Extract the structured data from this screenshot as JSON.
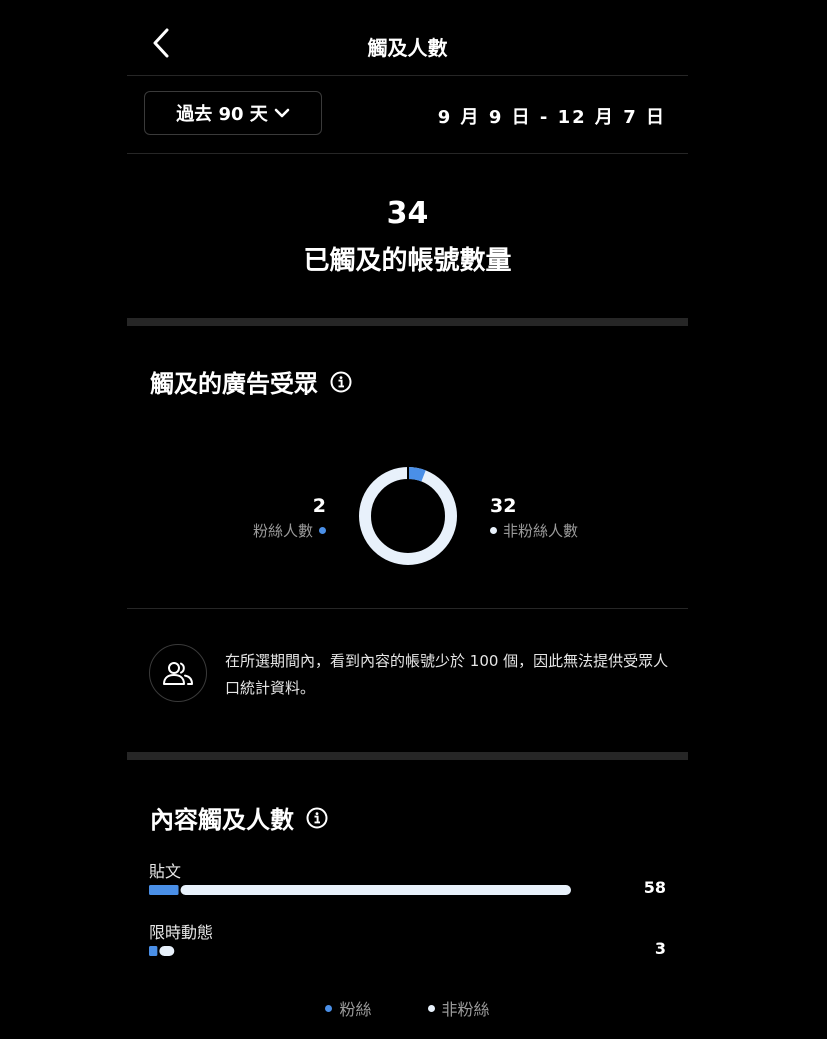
{
  "header": {
    "title": "觸及人數",
    "back_icon": "chevron-left-icon"
  },
  "date_filter": {
    "range_label": "過去 90 天",
    "date_range": "9 月 9 日 - 12 月 7 日"
  },
  "summary": {
    "total_value": "34",
    "total_label": "已觸及的帳號數量"
  },
  "audience": {
    "title": "觸及的廣告受眾",
    "followers_value": "2",
    "followers_label": "粉絲人數",
    "non_followers_value": "32",
    "non_followers_label": "非粉絲人數",
    "followers_count": 2,
    "non_followers_count": 32
  },
  "notice": {
    "icon": "people-icon",
    "text": "在所選期間內，看到內容的帳號少於 100 個，因此無法提供受眾人口統計資料。"
  },
  "content_reach": {
    "title": "內容觸及人數",
    "items": [
      {
        "label": "貼文",
        "value": "58",
        "follower_fraction": 0.07,
        "total_fraction": 1.0
      },
      {
        "label": "限時動態",
        "value": "3",
        "follower_fraction": 0.33,
        "total_fraction": 0.06
      }
    ]
  },
  "legend": {
    "followers": "粉絲",
    "non_followers": "非粉絲"
  },
  "colors": {
    "background": "#000000",
    "follower_blue": "#4a8fe7",
    "non_follower_white": "#e8f1fb",
    "divider": "#262626"
  }
}
